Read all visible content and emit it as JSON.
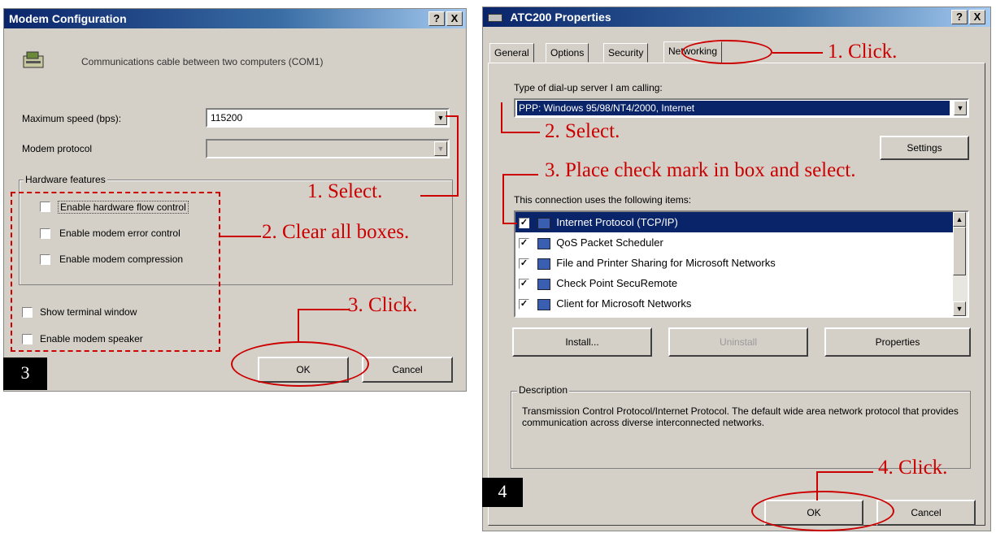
{
  "left_dialog": {
    "title": "Modem Configuration",
    "help_btn": "?",
    "close_btn": "X",
    "header_text": "Communications cable between two computers (COM1)",
    "max_speed_label": "Maximum speed (bps):",
    "max_speed_value": "115200",
    "modem_protocol_label": "Modem protocol",
    "hardware_group_label": "Hardware features",
    "checkboxes": [
      {
        "label": "Enable hardware flow control",
        "checked": false
      },
      {
        "label": "Enable modem error control",
        "checked": false
      },
      {
        "label": "Enable modem compression",
        "checked": false
      }
    ],
    "show_terminal_label": "Show terminal window",
    "enable_speaker_label": "Enable modem speaker",
    "ok_label": "OK",
    "cancel_label": "Cancel",
    "step_number": "3"
  },
  "right_dialog": {
    "title": "ATC200 Properties",
    "help_btn": "?",
    "close_btn": "X",
    "tabs": [
      "General",
      "Options",
      "Security",
      "Networking"
    ],
    "server_type_label": "Type of dial-up server I am calling:",
    "server_type_value": "PPP: Windows 95/98/NT4/2000, Internet",
    "settings_label": "Settings",
    "items_label": "This connection uses the following items:",
    "items": [
      {
        "label": "Internet Protocol (TCP/IP)",
        "checked": true
      },
      {
        "label": "QoS Packet Scheduler",
        "checked": true
      },
      {
        "label": "File and Printer Sharing for Microsoft Networks",
        "checked": true
      },
      {
        "label": "Check Point SecuRemote",
        "checked": true
      },
      {
        "label": "Client for Microsoft Networks",
        "checked": true
      }
    ],
    "install_label": "Install...",
    "uninstall_label": "Uninstall",
    "properties_label": "Properties",
    "description_label": "Description",
    "description_text": "Transmission Control Protocol/Internet Protocol. The default wide area network protocol that provides communication across diverse interconnected networks.",
    "ok_label": "OK",
    "cancel_label": "Cancel",
    "step_number": "4"
  },
  "annotations": {
    "left": [
      "1. Select.",
      "2. Clear all boxes.",
      "3. Click."
    ],
    "right": [
      "1. Click.",
      "2. Select.",
      "3. Place check mark in box and select.",
      "4. Click."
    ]
  },
  "colors": {
    "annotation": "#cc0000",
    "dialog_bg": "#d4d0c8",
    "title_start": "#0a246a",
    "selection": "#0a246a"
  }
}
